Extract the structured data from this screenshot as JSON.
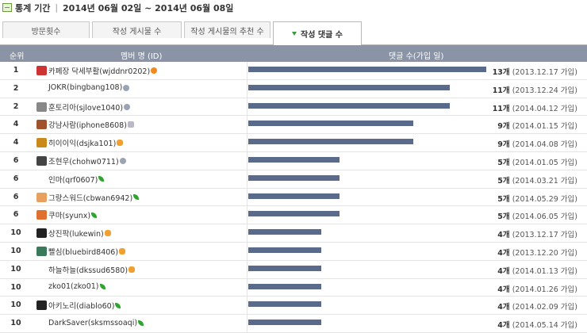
{
  "header": {
    "label": "통계 기간",
    "period": "2014년 06월 02일 ~ 2014년 06월 08일"
  },
  "tabs": [
    {
      "label": "방문횟수",
      "active": false
    },
    {
      "label": "작성 게시물 수",
      "active": false
    },
    {
      "label": "작성 게시물의 추천 수",
      "active": false
    },
    {
      "label": "작성 댓글 수",
      "active": true
    }
  ],
  "table": {
    "headers": {
      "rank": "순위",
      "member": "멤버 명 (ID)",
      "count": "댓글 수(가입 일)"
    },
    "rows": [
      {
        "rank": "1",
        "name": "카페장 닥세부활(wjddnr0202)",
        "count": "13개",
        "joined": "(2013.12.17 가입)",
        "value": 13,
        "avatar": "#c33",
        "badge": "gear-orange"
      },
      {
        "rank": "2",
        "name": "JOKR(bingbang108)",
        "count": "11개",
        "joined": "(2013.12.24 가입)",
        "value": 11,
        "avatar": "",
        "badge": "gear-gray"
      },
      {
        "rank": "2",
        "name": "훈토리아(sjlove1040)",
        "count": "11개",
        "joined": "(2014.04.12 가입)",
        "value": 11,
        "avatar": "#888",
        "badge": "gear-gray"
      },
      {
        "rank": "4",
        "name": "강남사람(iphone8608)",
        "count": "9개",
        "joined": "(2014.01.15 가입)",
        "value": 9,
        "avatar": "#a0522d",
        "badge": "gem-gray"
      },
      {
        "rank": "4",
        "name": "히이이익(dsjka101)",
        "count": "9개",
        "joined": "(2014.04.08 가입)",
        "value": 9,
        "avatar": "#c98a1a",
        "badge": "hand-orange"
      },
      {
        "rank": "6",
        "name": "조현우(chohw0711)",
        "count": "5개",
        "joined": "(2014.01.05 가입)",
        "value": 5,
        "avatar": "#444",
        "badge": "gear-gray"
      },
      {
        "rank": "6",
        "name": "인마(qrf0607)",
        "count": "5개",
        "joined": "(2014.03.21 가입)",
        "value": 5,
        "avatar": "",
        "badge": "leaf"
      },
      {
        "rank": "6",
        "name": "그랑스워드(cbwan6942)",
        "count": "5개",
        "joined": "(2014.05.29 가입)",
        "value": 5,
        "avatar": "#e8a060",
        "badge": "leaf"
      },
      {
        "rank": "6",
        "name": "쿠마(syunx)",
        "count": "5개",
        "joined": "(2014.06.05 가입)",
        "value": 5,
        "avatar": "#e07030",
        "badge": "leaf"
      },
      {
        "rank": "10",
        "name": "상진팍(lukewin)",
        "count": "4개",
        "joined": "(2013.12.17 가입)",
        "value": 4,
        "avatar": "#222",
        "badge": "hand-orange"
      },
      {
        "rank": "10",
        "name": "빨심(bluebird8406)",
        "count": "4개",
        "joined": "(2013.12.20 가입)",
        "value": 4,
        "avatar": "#3a7a5a",
        "badge": "hand-orange"
      },
      {
        "rank": "10",
        "name": "하늘하늘(dkssud6580)",
        "count": "4개",
        "joined": "(2014.01.13 가입)",
        "value": 4,
        "avatar": "",
        "badge": "hand-orange"
      },
      {
        "rank": "10",
        "name": "zko01(zko01)",
        "count": "4개",
        "joined": "(2014.01.26 가입)",
        "value": 4,
        "avatar": "",
        "badge": "leaf"
      },
      {
        "rank": "10",
        "name": "아키노리(diablo60)",
        "count": "4개",
        "joined": "(2014.02.09 가입)",
        "value": 4,
        "avatar": "#222",
        "badge": "leaf"
      },
      {
        "rank": "10",
        "name": "DarkSaver(sksmssoaqi)",
        "count": "4개",
        "joined": "(2014.05.14 가입)",
        "value": 4,
        "avatar": "",
        "badge": "leaf"
      }
    ]
  }
}
